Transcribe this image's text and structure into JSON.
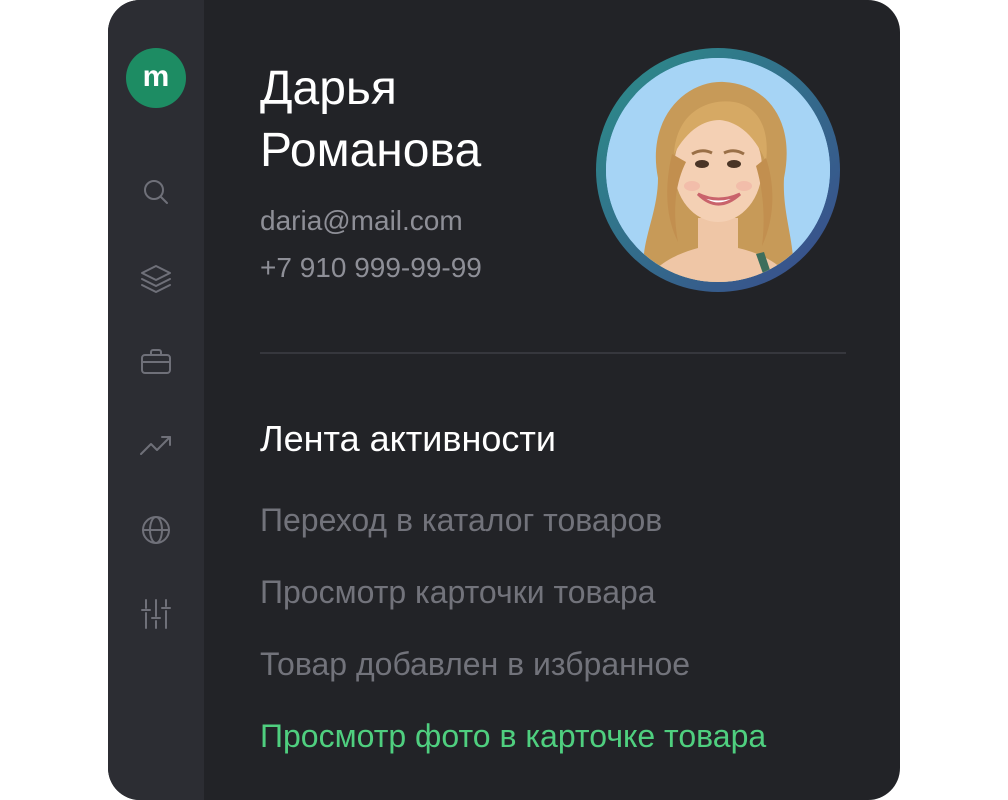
{
  "logo": {
    "glyph": "m",
    "color": "#1d8c63"
  },
  "sidebar": {
    "items": [
      {
        "icon": "search-icon"
      },
      {
        "icon": "layers-icon"
      },
      {
        "icon": "briefcase-icon"
      },
      {
        "icon": "trending-up-icon"
      },
      {
        "icon": "globe-icon"
      },
      {
        "icon": "sliders-icon"
      }
    ]
  },
  "profile": {
    "name_line1": "Дарья",
    "name_line2": "Романова",
    "email": "daria@mail.com",
    "phone": "+7 910 999-99-99",
    "avatar": "profile-photo"
  },
  "feed": {
    "title": "Лента активности",
    "items": [
      {
        "label": "Переход в каталог товаров",
        "state": "past"
      },
      {
        "label": "Просмотр карточки товара",
        "state": "past"
      },
      {
        "label": "Товар добавлен в избранное",
        "state": "past"
      },
      {
        "label": "Просмотр фото в карточке товара",
        "state": "current"
      }
    ],
    "colors": {
      "past": "#72737b",
      "current": "#4fcf7f"
    }
  }
}
